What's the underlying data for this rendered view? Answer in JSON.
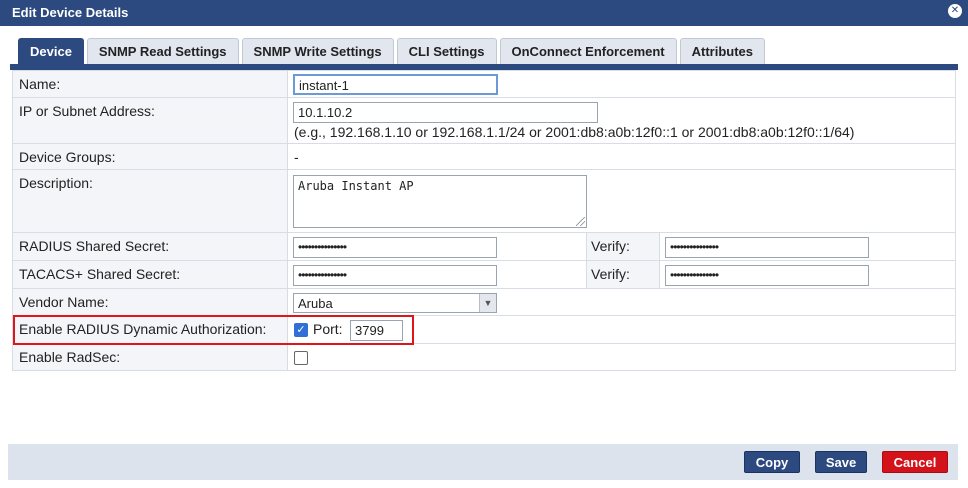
{
  "dialog": {
    "title": "Edit Device Details",
    "close_glyph": "✕"
  },
  "tabs": [
    {
      "label": "Device"
    },
    {
      "label": "SNMP Read Settings"
    },
    {
      "label": "SNMP Write Settings"
    },
    {
      "label": "CLI Settings"
    },
    {
      "label": "OnConnect Enforcement"
    },
    {
      "label": "Attributes"
    }
  ],
  "form": {
    "name": {
      "label": "Name:",
      "value": "instant-1"
    },
    "ip": {
      "label": "IP or Subnet Address:",
      "value": "10.1.10.2",
      "hint": "(e.g., 192.168.1.10 or 192.168.1.1/24 or 2001:db8:a0b:12f0::1 or 2001:db8:a0b:12f0::1/64)"
    },
    "groups": {
      "label": "Device Groups:",
      "value": "-"
    },
    "description": {
      "label": "Description:",
      "value": "Aruba Instant AP"
    },
    "radius_secret": {
      "label": "RADIUS Shared Secret:",
      "value": "•••••••••••••••",
      "verify_label": "Verify:",
      "verify_value": "•••••••••••••••"
    },
    "tacacs_secret": {
      "label": "TACACS+ Shared Secret:",
      "value": "•••••••••••••••",
      "verify_label": "Verify:",
      "verify_value": "•••••••••••••••"
    },
    "vendor": {
      "label": "Vendor Name:",
      "value": "Aruba"
    },
    "radius_dyn": {
      "label": "Enable RADIUS Dynamic Authorization:",
      "checked": true,
      "port_label": "Port:",
      "port_value": "3799"
    },
    "radsec": {
      "label": "Enable RadSec:",
      "checked": false
    }
  },
  "buttons": {
    "copy": "Copy",
    "save": "Save",
    "cancel": "Cancel"
  },
  "colors": {
    "header": "#2c4a7f",
    "cancel": "#d4121a",
    "highlight": "#e0151b",
    "checkbox": "#2f6fd6"
  }
}
